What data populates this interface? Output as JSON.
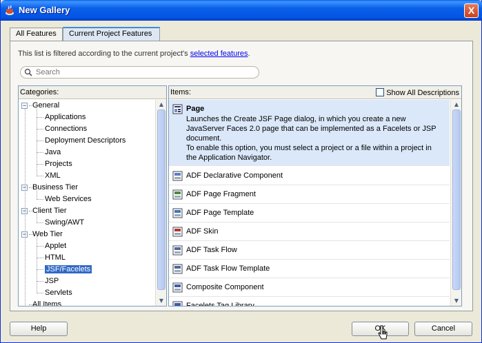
{
  "window": {
    "title": "New Gallery",
    "close_label": "X"
  },
  "tabs": [
    {
      "label": "All Features"
    },
    {
      "label": "Current Project Features"
    }
  ],
  "filter": {
    "text": "This list is filtered according to the current project's ",
    "link": "selected features",
    "suffix": "."
  },
  "search": {
    "placeholder": "Search"
  },
  "categories": {
    "header": "Categories:",
    "tree": [
      {
        "label": "General",
        "level": 0,
        "expanded": true
      },
      {
        "label": "Applications",
        "level": 1
      },
      {
        "label": "Connections",
        "level": 1
      },
      {
        "label": "Deployment Descriptors",
        "level": 1
      },
      {
        "label": "Java",
        "level": 1
      },
      {
        "label": "Projects",
        "level": 1
      },
      {
        "label": "XML",
        "level": 1
      },
      {
        "label": "Business Tier",
        "level": 0,
        "expanded": true
      },
      {
        "label": "Web Services",
        "level": 1
      },
      {
        "label": "Client Tier",
        "level": 0,
        "expanded": true
      },
      {
        "label": "Swing/AWT",
        "level": 1
      },
      {
        "label": "Web Tier",
        "level": 0,
        "expanded": true
      },
      {
        "label": "Applet",
        "level": 1
      },
      {
        "label": "HTML",
        "level": 1
      },
      {
        "label": "JSF/Facelets",
        "level": 1,
        "selected": true
      },
      {
        "label": "JSP",
        "level": 1
      },
      {
        "label": "Servlets",
        "level": 1
      },
      {
        "label": "All Items",
        "level": 0
      }
    ]
  },
  "items": {
    "header": "Items:",
    "show_all_label": "Show All Descriptions",
    "featured": {
      "name": "Page",
      "description": "Launches the Create JSF Page dialog, in which you create a new JavaServer Faces 2.0 page that can be implemented as a Facelets or JSP document.",
      "note": "To enable this option, you must select a project or a file within a project in the Application Navigator."
    },
    "list": [
      {
        "name": "ADF Declarative Component",
        "icon": "adf-component-icon"
      },
      {
        "name": "ADF Page Fragment",
        "icon": "adf-fragment-icon"
      },
      {
        "name": "ADF Page Template",
        "icon": "adf-template-icon"
      },
      {
        "name": "ADF Skin",
        "icon": "adf-skin-icon"
      },
      {
        "name": "ADF Task Flow",
        "icon": "task-flow-icon"
      },
      {
        "name": "ADF Task Flow Template",
        "icon": "task-flow-template-icon"
      },
      {
        "name": "Composite Component",
        "icon": "composite-component-icon"
      },
      {
        "name": "Facelets Tag Library",
        "icon": "tag-library-icon"
      }
    ]
  },
  "buttons": {
    "help": "Help",
    "ok": "OK",
    "cancel": "Cancel"
  },
  "colors": {
    "selection": "#3169c6",
    "featured_bg": "#dbe8f9",
    "titlebar": "#0a5fe8"
  }
}
